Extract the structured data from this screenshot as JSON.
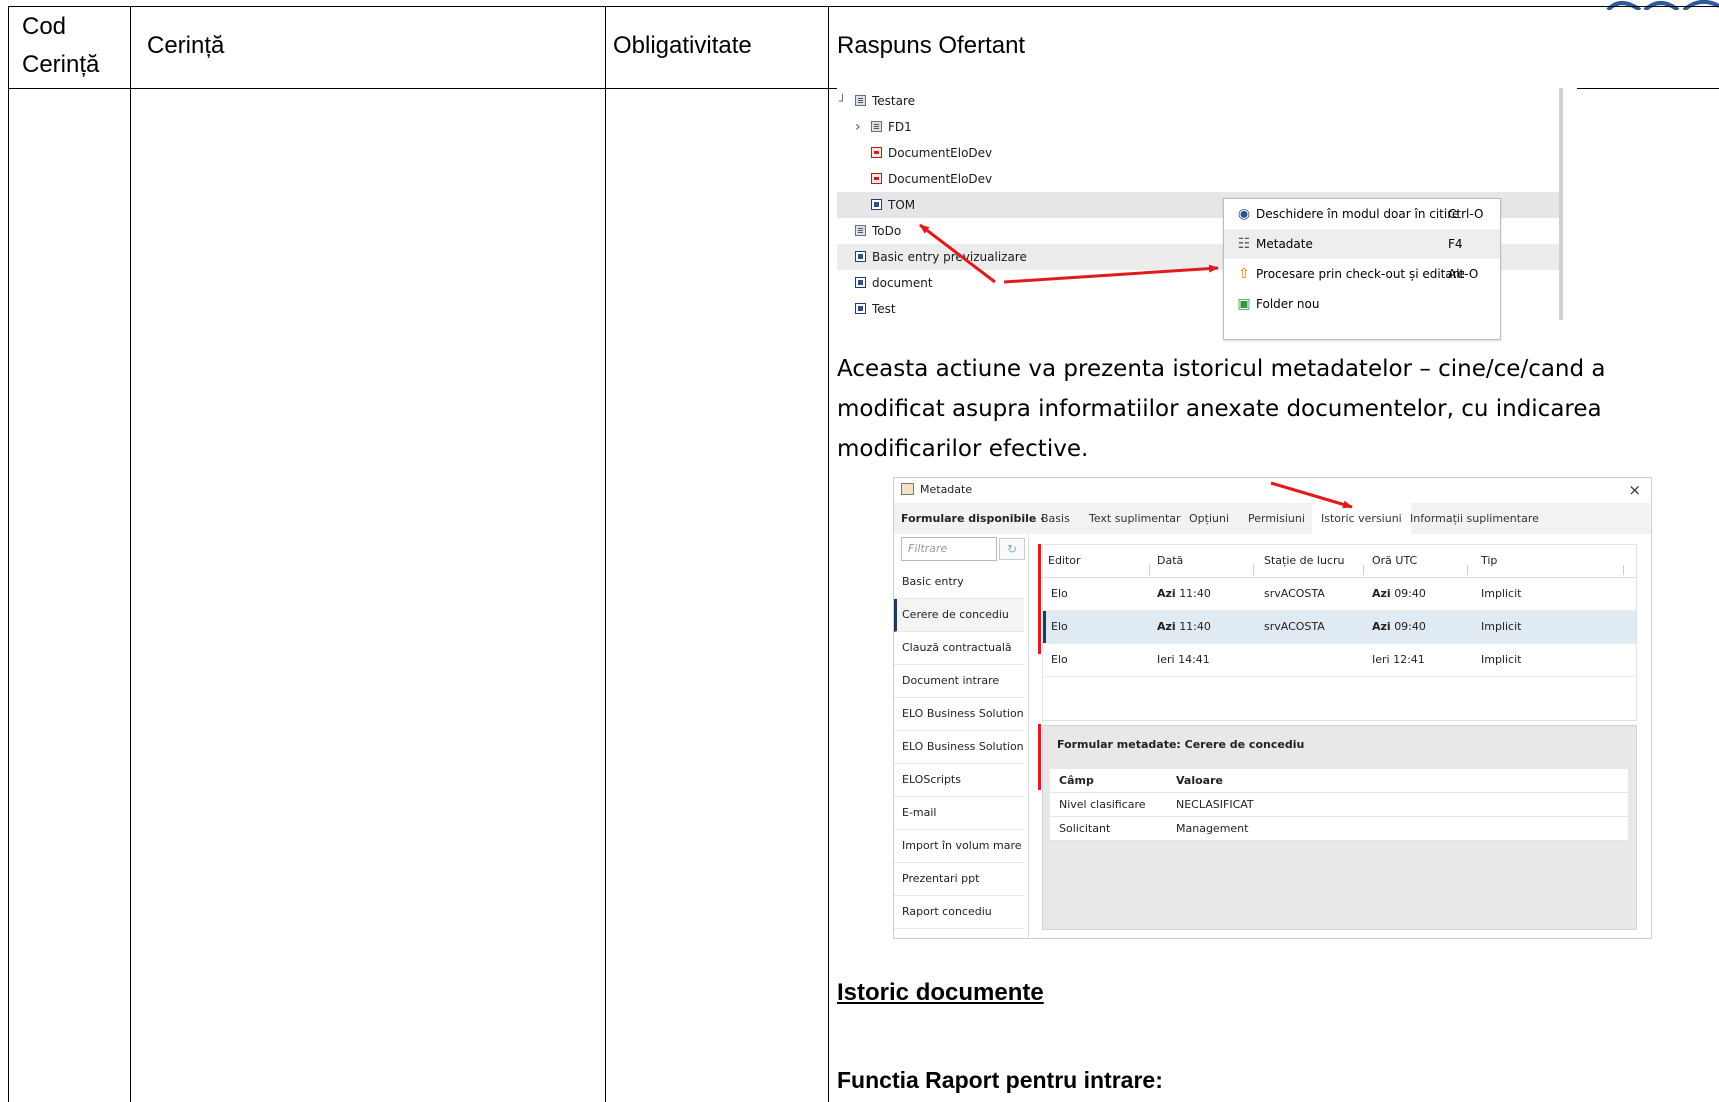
{
  "table": {
    "headers": {
      "code_line1": "Cod",
      "code_line2": "Cerință",
      "requirement": "Cerință",
      "mandatory": "Obligativitate",
      "response": "Raspuns Ofertant"
    }
  },
  "tree": {
    "items": [
      {
        "label": "Testare",
        "icon": "folder-icon",
        "expander": "┘"
      },
      {
        "label": "FD1",
        "icon": "folder-icon",
        "expander": "›"
      },
      {
        "label": "DocumentEloDev",
        "icon": "pdf-icon"
      },
      {
        "label": "DocumentEloDev",
        "icon": "pdf-icon"
      },
      {
        "label": "TOM",
        "icon": "word-doc-icon"
      },
      {
        "label": "ToDo",
        "icon": "folder-icon"
      },
      {
        "label": "Basic entry previzualizare",
        "icon": "word-doc-icon"
      },
      {
        "label": "document",
        "icon": "word-doc-icon"
      },
      {
        "label": "Test",
        "icon": "word-doc-icon"
      }
    ],
    "context_menu": [
      {
        "label": "Deschidere în modul doar în citire",
        "shortcut": "Ctrl-O",
        "icon": "eye-icon"
      },
      {
        "label": "Metadate",
        "shortcut": "F4",
        "icon": "metadata-icon"
      },
      {
        "label": "Procesare prin check-out și editare",
        "shortcut": "Alt-O",
        "icon": "checkout-icon"
      },
      {
        "label": "Folder nou",
        "shortcut": "",
        "icon": "new-folder-icon"
      }
    ]
  },
  "paragraph": "Aceasta actiune va prezenta istoricul metadatelor – cine/ce/cand a modificat asupra informatiilor anexate documentelor, cu indicarea modificarilor efective.",
  "dialog": {
    "title": "Metadate",
    "close": "×",
    "forms_heading": "Formulare disponibile ‹",
    "tabs": [
      "Basis",
      "Text suplimentar",
      "Opțiuni",
      "Permisiuni",
      "Istoric versiuni",
      "Informații suplimentare"
    ],
    "active_tab": "Istoric versiuni",
    "filter_placeholder": "Filtrare",
    "filter_icon": "↻",
    "forms": [
      "Basic entry",
      "Cerere de concediu",
      "Clauză contractuală",
      "Document intrare",
      "ELO Business Solution T",
      "ELO Business Solution T",
      "ELOScripts",
      "E-mail",
      "Import în volum mare",
      "Prezentari ppt",
      "Raport concediu"
    ],
    "active_form": "Cerere de concediu",
    "history": {
      "columns": [
        "Editor",
        "Dată",
        "Stație de lucru",
        "Oră UTC",
        "Tip"
      ],
      "rows": [
        {
          "editor": "Elo",
          "date_day": "Azi",
          "date_time": "11:40",
          "workstation": "srvACOSTA",
          "utc_day": "Azi",
          "utc_time": "09:40",
          "type": "Implicit"
        },
        {
          "editor": "Elo",
          "date_day": "Azi",
          "date_time": "11:40",
          "workstation": "srvACOSTA",
          "utc_day": "Azi",
          "utc_time": "09:40",
          "type": "Implicit"
        },
        {
          "editor": "Elo",
          "date_day": "Ieri",
          "date_time": "14:41",
          "workstation": "",
          "utc_day": "Ieri",
          "utc_time": "12:41",
          "type": "Implicit"
        }
      ]
    },
    "detail": {
      "title": "Formular metadate: Cerere de concediu",
      "col_field": "Câmp",
      "col_value": "Valoare",
      "rows": [
        {
          "field": "Nivel clasificare",
          "value": "NECLASIFICAT"
        },
        {
          "field": "Solicitant",
          "value": "Management"
        }
      ]
    }
  },
  "section_heading": "Istoric documente",
  "function_line": "Functia Raport pentru intrare:",
  "colors": {
    "arrow": "#e01b1b",
    "selection": "#dfeaf3",
    "accent": "#1d3a66"
  }
}
